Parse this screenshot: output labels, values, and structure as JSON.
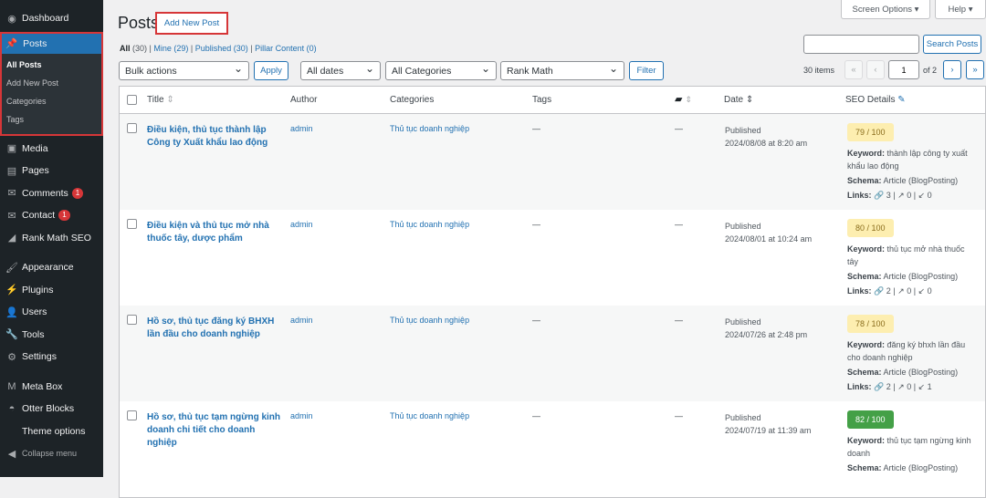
{
  "sidebar": {
    "items": [
      {
        "label": "Dashboard",
        "icon": "dashboard-icon"
      },
      {
        "label": "Media"
      },
      {
        "label": "Pages"
      },
      {
        "label": "Comments",
        "badge": "1"
      },
      {
        "label": "Contact",
        "badge": "1"
      },
      {
        "label": "Rank Math SEO"
      },
      {
        "label": "Appearance"
      },
      {
        "label": "Plugins"
      },
      {
        "label": "Users"
      },
      {
        "label": "Tools"
      },
      {
        "label": "Settings"
      },
      {
        "label": "Meta Box"
      },
      {
        "label": "Otter Blocks"
      },
      {
        "label": "Theme options"
      },
      {
        "label": "Collapse menu"
      }
    ],
    "posts": {
      "label": "Posts",
      "sub": [
        "All Posts",
        "Add New Post",
        "Categories",
        "Tags"
      ]
    }
  },
  "header": {
    "title": "Posts",
    "add_new": "Add New Post",
    "screen_options": "Screen Options ▾",
    "help": "Help ▾"
  },
  "filters": {
    "all": "All",
    "all_count": "(30)",
    "mine": "Mine (29)",
    "published": "Published (30)",
    "pillar": "Pillar Content (0)",
    "bulk": "Bulk actions",
    "apply": "Apply",
    "dates": "All dates",
    "categories": "All Categories",
    "rankmath": "Rank Math",
    "filter": "Filter",
    "search_button": "Search Posts",
    "search_value": "",
    "items": "30 items",
    "first": "«",
    "prev": "‹",
    "page": "1",
    "of": "of 2",
    "next": "›",
    "last": "»"
  },
  "columns": {
    "title": "Title",
    "author": "Author",
    "categories": "Categories",
    "tags": "Tags",
    "date": "Date",
    "seo": "SEO Details"
  },
  "seo_labels": {
    "keyword": "Keyword:",
    "schema": "Schema:",
    "links": "Links:"
  },
  "rows": [
    {
      "title": "Điều kiện, thủ tục thành lập Công ty Xuất khẩu lao động",
      "author": "admin",
      "category": "Thủ tục doanh nghiệp",
      "tags": "—",
      "comments": "—",
      "status": "Published",
      "date": "2024/08/08 at 8:20 am",
      "score": "79 / 100",
      "keyword": "thành lập công ty xuất khẩu lao động",
      "schema": "Article (BlogPosting)",
      "links": [
        "3",
        "0",
        "0"
      ]
    },
    {
      "title": "Điều kiện và thủ tục mở nhà thuốc tây, dược phẩm",
      "author": "admin",
      "category": "Thủ tục doanh nghiệp",
      "tags": "—",
      "comments": "—",
      "status": "Published",
      "date": "2024/08/01 at 10:24 am",
      "score": "80 / 100",
      "keyword": "thủ tục mở nhà thuốc tây",
      "schema": "Article (BlogPosting)",
      "links": [
        "2",
        "0",
        "0"
      ]
    },
    {
      "title": "Hồ sơ, thủ tục đăng ký BHXH lần đầu cho doanh nghiệp",
      "author": "admin",
      "category": "Thủ tục doanh nghiệp",
      "tags": "—",
      "comments": "—",
      "status": "Published",
      "date": "2024/07/26 at 2:48 pm",
      "score": "78 / 100",
      "keyword": "đăng ký bhxh lần đầu cho doanh nghiệp",
      "schema": "Article (BlogPosting)",
      "links": [
        "2",
        "0",
        "1"
      ]
    },
    {
      "title": "Hồ sơ, thủ tục tạm ngừng kinh doanh chi tiết cho doanh nghiệp",
      "author": "admin",
      "category": "Thủ tục doanh nghiệp",
      "tags": "—",
      "comments": "—",
      "status": "Published",
      "date": "2024/07/19 at 11:39 am",
      "score": "82 / 100",
      "keyword": "thủ tục tạm ngừng kinh doanh",
      "schema": "Article (BlogPosting)",
      "links": []
    }
  ]
}
